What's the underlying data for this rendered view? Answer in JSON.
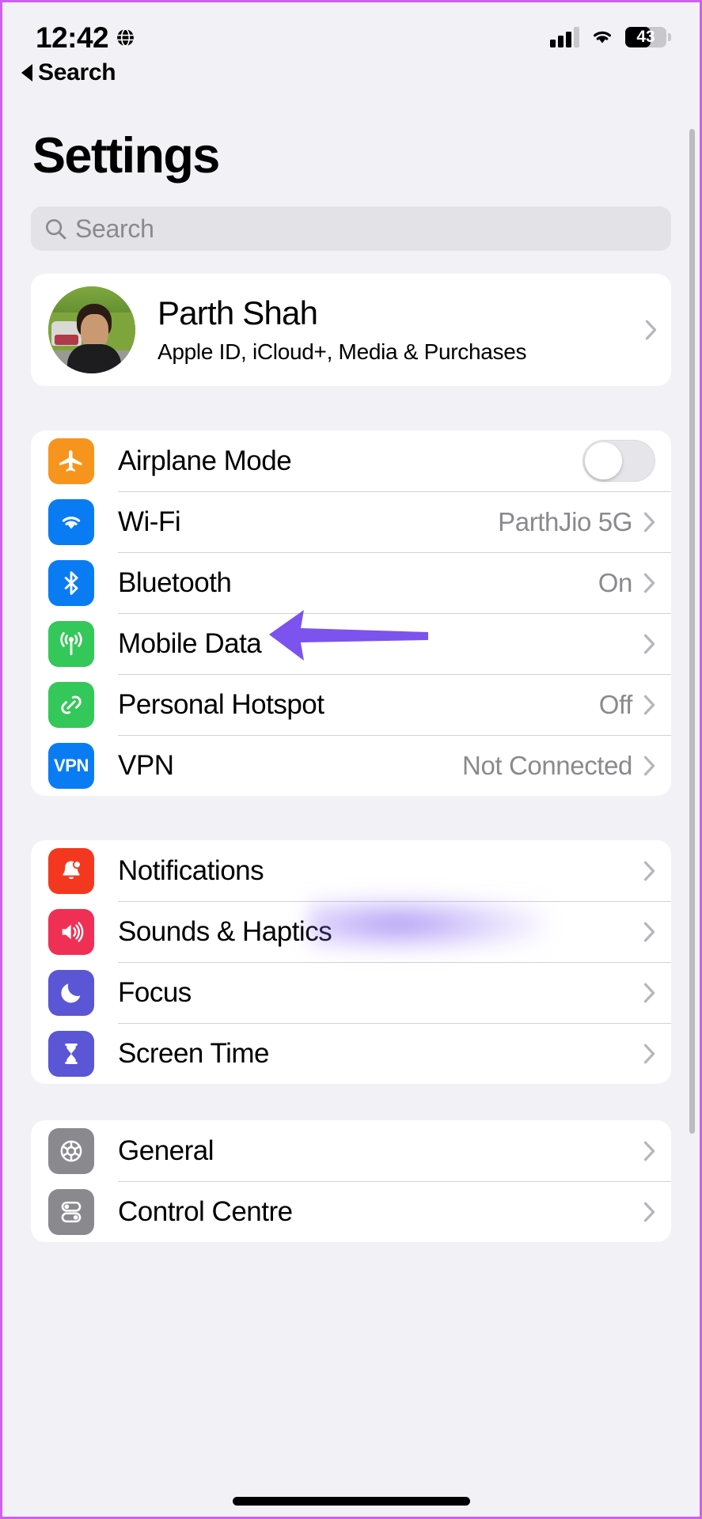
{
  "status_bar": {
    "time": "12:42",
    "location_icon": "globe-icon",
    "signal_icon": "cellular-signal-icon",
    "wifi_icon": "wifi-icon",
    "battery_percent": "43"
  },
  "nav": {
    "back_label": "Search"
  },
  "header": {
    "title": "Settings"
  },
  "search": {
    "placeholder": "Search",
    "icon": "search-icon"
  },
  "profile": {
    "name": "Parth Shah",
    "subtitle": "Apple ID, iCloud+, Media & Purchases",
    "avatar": "user-avatar"
  },
  "colors": {
    "page_background": "#f2f1f6",
    "card_background": "#ffffff",
    "separator": "#d2d1d6",
    "value_text": "#8a8a8e",
    "frame_border": "#cf5ff0",
    "annotation_arrow": "#7c53ee",
    "airplane_orange": "#f7941d",
    "wifi_blue": "#0a7cf3",
    "bluetooth_blue": "#0a7cf3",
    "mobile_green": "#34c759",
    "hotspot_green": "#34c759",
    "vpn_blue": "#0a7cf3",
    "notifications_red": "#f4381f",
    "sounds_pink": "#f02f55",
    "focus_indigo": "#5a56d6",
    "screentime_indigo": "#5a56d6",
    "general_grey": "#8a8a8e",
    "controlcentre_grey": "#8a8a8e"
  },
  "groups": [
    {
      "id": "connectivity",
      "rows": [
        {
          "label": "Airplane Mode",
          "value": "",
          "icon": "airplane-icon",
          "icon_color": "#f7941d",
          "control": "toggle",
          "toggle_on": false
        },
        {
          "label": "Wi-Fi",
          "value": "ParthJio 5G",
          "icon": "wifi-icon",
          "icon_color": "#0a7cf3",
          "control": "chevron"
        },
        {
          "label": "Bluetooth",
          "value": "On",
          "icon": "bluetooth-icon",
          "icon_color": "#0a7cf3",
          "control": "chevron"
        },
        {
          "label": "Mobile Data",
          "value": "",
          "icon": "cellular-icon",
          "icon_color": "#34c759",
          "control": "chevron",
          "annotated": true
        },
        {
          "label": "Personal Hotspot",
          "value": "Off",
          "icon": "hotspot-icon",
          "icon_color": "#34c759",
          "control": "chevron"
        },
        {
          "label": "VPN",
          "value": "Not Connected",
          "icon": "vpn-icon",
          "icon_color": "#0a7cf3",
          "icon_text": "VPN",
          "control": "chevron"
        }
      ]
    },
    {
      "id": "alerts",
      "rows": [
        {
          "label": "Notifications",
          "value": "",
          "icon": "bell-icon",
          "icon_color": "#f4381f",
          "control": "chevron"
        },
        {
          "label": "Sounds & Haptics",
          "value": "",
          "icon": "speaker-icon",
          "icon_color": "#f02f55",
          "control": "chevron"
        },
        {
          "label": "Focus",
          "value": "",
          "icon": "moon-icon",
          "icon_color": "#5a56d6",
          "control": "chevron"
        },
        {
          "label": "Screen Time",
          "value": "",
          "icon": "hourglass-icon",
          "icon_color": "#5a56d6",
          "control": "chevron"
        }
      ]
    },
    {
      "id": "system",
      "rows": [
        {
          "label": "General",
          "value": "",
          "icon": "gear-icon",
          "icon_color": "#8a8a8e",
          "control": "chevron"
        },
        {
          "label": "Control Centre",
          "value": "",
          "icon": "sliders-icon",
          "icon_color": "#8a8a8e",
          "control": "chevron"
        }
      ]
    }
  ]
}
